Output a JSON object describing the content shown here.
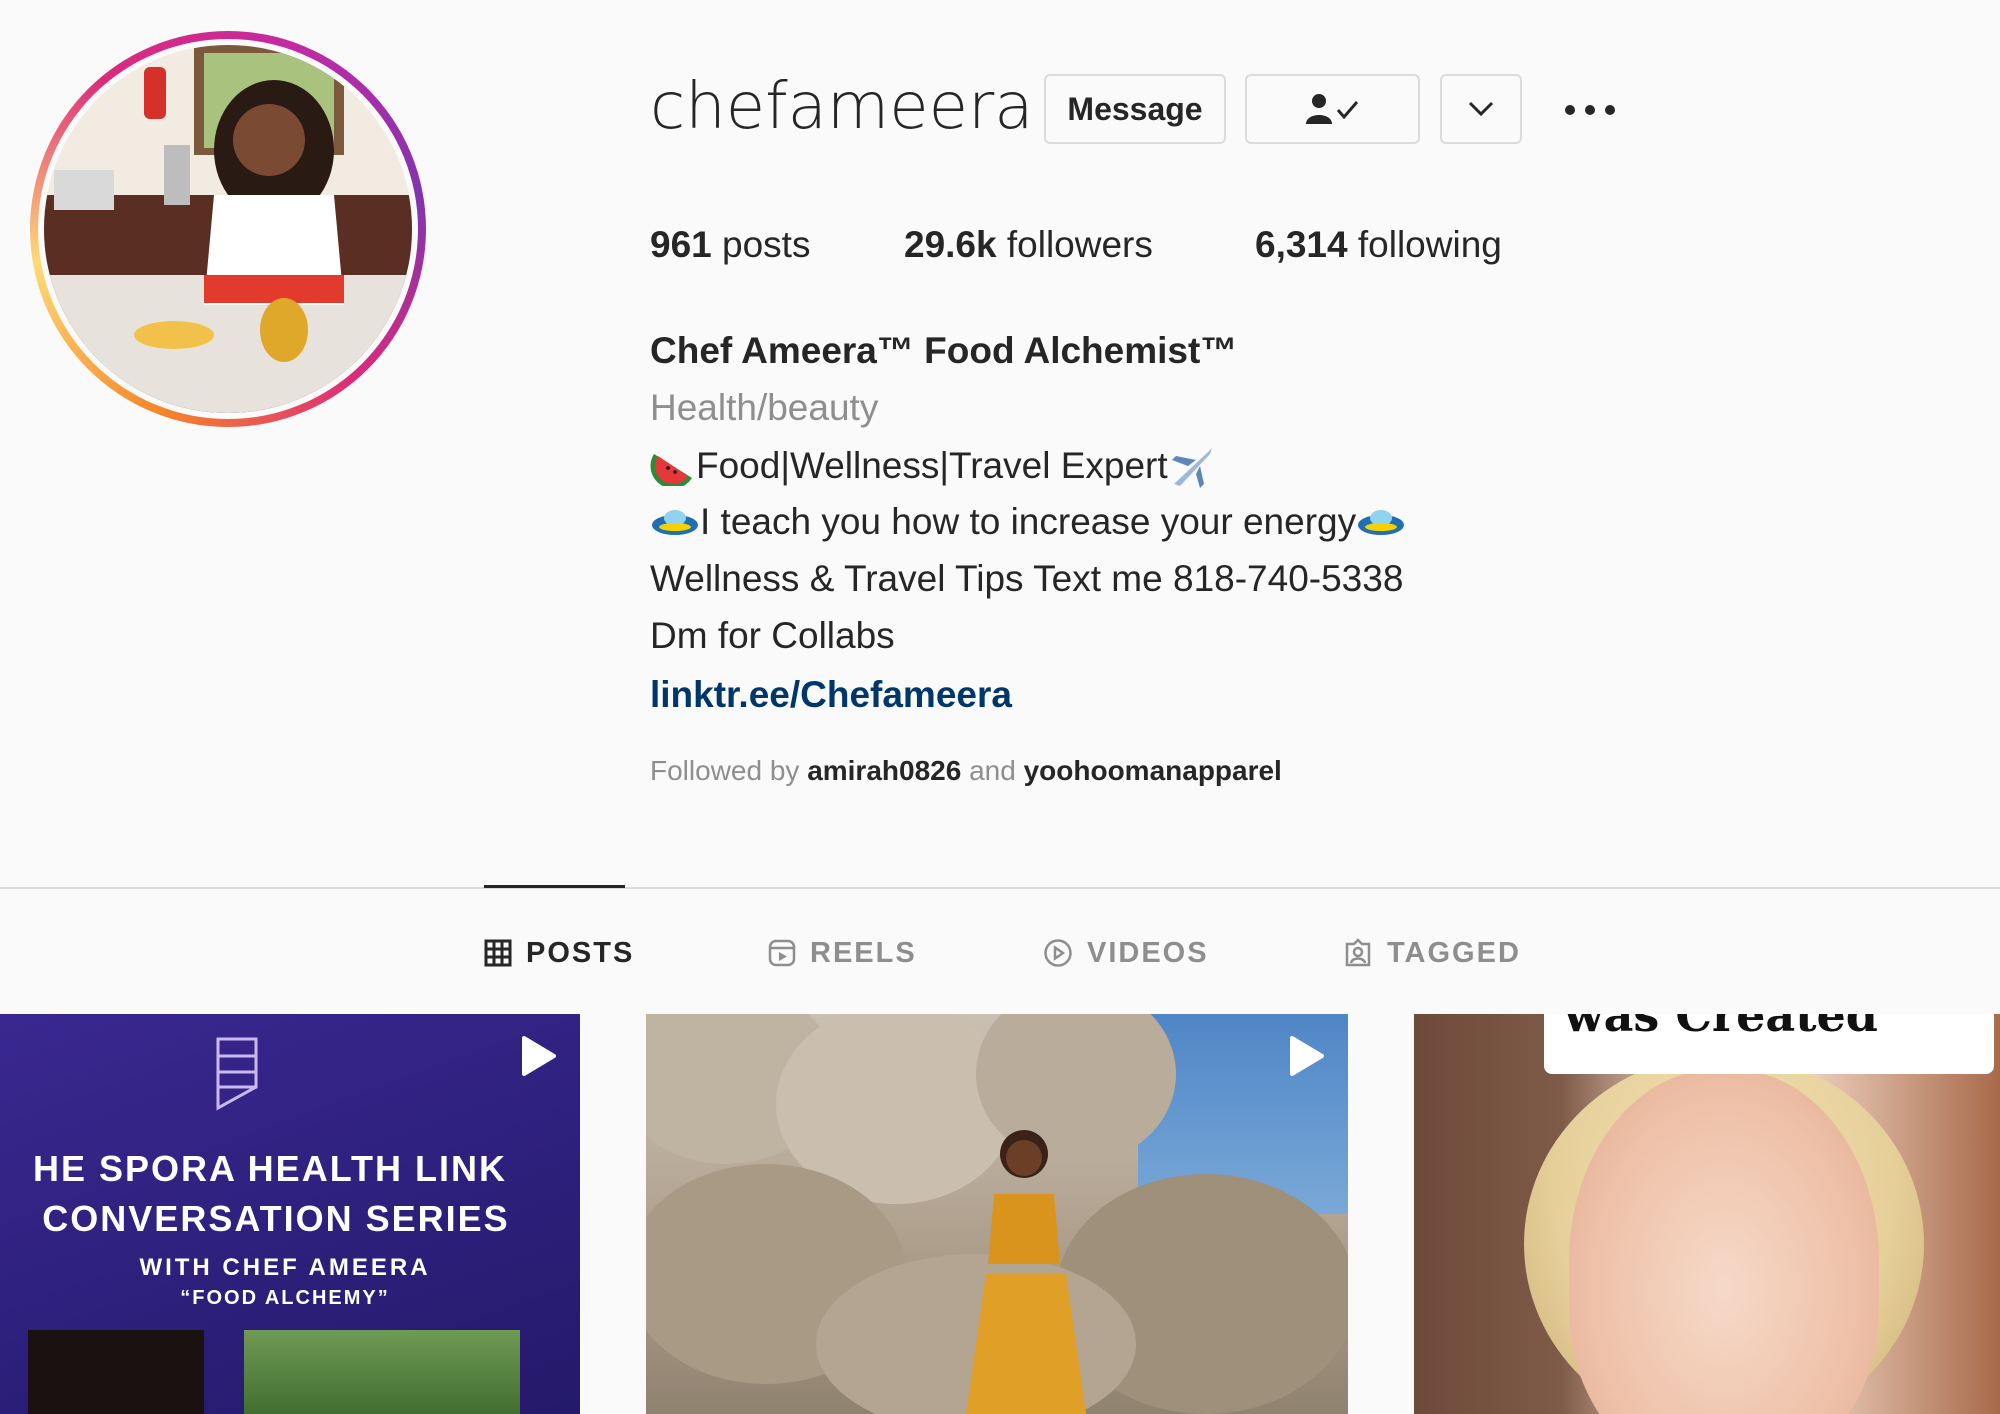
{
  "profile": {
    "username": "chefameera",
    "buttons": {
      "message": "Message",
      "following_icon": "person-check-icon",
      "suggest_icon": "chevron-down-icon",
      "more_icon": "more-dots-icon"
    },
    "stats": {
      "posts_count": "961",
      "posts_label": "posts",
      "followers_count": "29.6k",
      "followers_label": "followers",
      "following_count": "6,314",
      "following_label": "following"
    },
    "bio": {
      "name": "Chef Ameera™ Food Alchemist™",
      "category": "Health/beauty",
      "line1": "Food|Wellness|Travel Expert",
      "line1_icons": [
        "watermelon-emoji",
        "airplane-emoji"
      ],
      "line2": "I teach you how to increase your energy ",
      "line2_icons": [
        "flying-saucer-emoji",
        "flying-saucer-emoji"
      ],
      "line3": "Wellness & Travel Tips Text me 818-740-5338",
      "line4": "Dm for Collabs",
      "link": "linktr.ee/Chefameera"
    },
    "followed_by": {
      "prefix": "Followed by",
      "user1": "amirah0826",
      "conjunction": "and",
      "user2": "yoohoomanapparel"
    }
  },
  "tabs": [
    {
      "label": "POSTS",
      "icon": "grid-icon",
      "active": true
    },
    {
      "label": "REELS",
      "icon": "reels-icon",
      "active": false
    },
    {
      "label": "VIDEOS",
      "icon": "video-play-icon",
      "active": false
    },
    {
      "label": "TAGGED",
      "icon": "tagged-icon",
      "active": false
    }
  ],
  "posts": [
    {
      "type": "reel",
      "title_line1": "HE SPORA HEALTH LINK",
      "title_line2": "CONVERSATION SERIES",
      "subtitle_line1": "WITH CHEF AMEERA",
      "subtitle_line2": "“FOOD ALCHEMY”"
    },
    {
      "type": "reel"
    },
    {
      "type": "image",
      "caption": "was Created"
    }
  ],
  "colors": {
    "text_primary": "#262626",
    "text_secondary": "#8e8e8e",
    "link": "#00376b",
    "border": "#dbdbdb",
    "background": "#fafafa"
  }
}
